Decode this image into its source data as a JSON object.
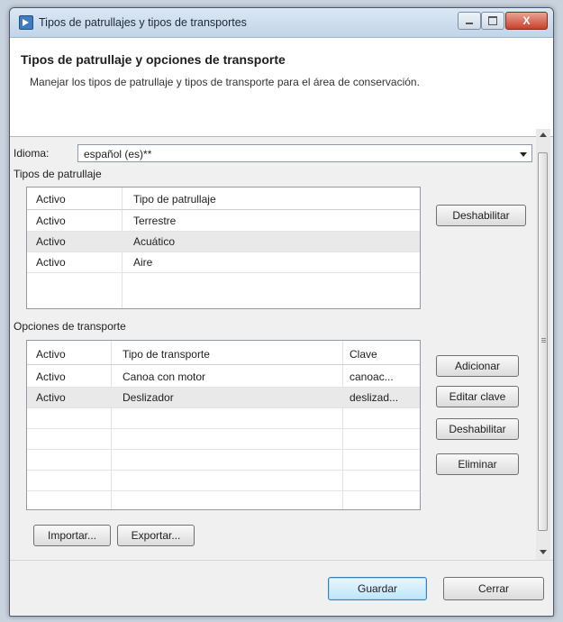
{
  "window": {
    "title": "Tipos de patrullajes y tipos de transportes",
    "close_label": "X"
  },
  "header": {
    "title": "Tipos de patrullaje y opciones de transporte",
    "description": "Manejar los tipos de patrullaje y tipos de transporte para el área de conservación."
  },
  "language": {
    "label": "Idioma:",
    "value": "español (es)**"
  },
  "patrol_types": {
    "section_label": "Tipos de patrullaje",
    "headers": [
      "Activo",
      "Tipo de patrullaje"
    ],
    "rows": [
      [
        "Activo",
        "Terrestre"
      ],
      [
        "Activo",
        "Acuático"
      ],
      [
        "Activo",
        "Aire"
      ]
    ],
    "disable_button": "Deshabilitar"
  },
  "transport": {
    "section_label": "Opciones de transporte",
    "headers": [
      "Activo",
      "Tipo de transporte",
      "Clave"
    ],
    "rows": [
      [
        "Activo",
        "Canoa con motor",
        "canoac..."
      ],
      [
        "Activo",
        "Deslizador",
        "deslizad..."
      ]
    ],
    "add_button": "Adicionar",
    "edit_key_button": "Editar clave",
    "disable_button": "Deshabilitar",
    "delete_button": "Eliminar"
  },
  "import_button": "Importar...",
  "export_button": "Exportar...",
  "save_button": "Guardar",
  "close_button": "Cerrar"
}
